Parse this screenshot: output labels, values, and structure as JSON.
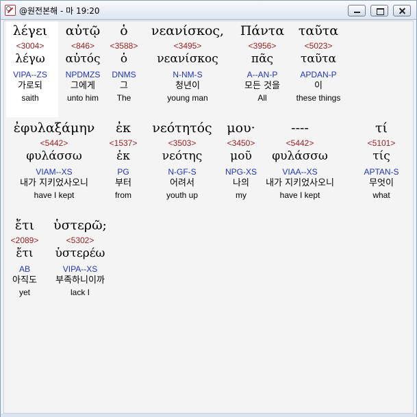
{
  "window": {
    "title": "@원전본해 - 마 19:20"
  },
  "rows": [
    {
      "words": [
        {
          "greek": "λέγει",
          "strong": "<3004>",
          "lemma": "λέγω",
          "parse": "VIPA--ZS",
          "korean": "가로되",
          "english": "saith"
        },
        {
          "greek": "αὐτῷ",
          "strong": "<846>",
          "lemma": "αὐτός",
          "parse": "NPDMZS",
          "korean": "그에게",
          "english": "unto him"
        },
        {
          "greek": "ὁ",
          "strong": "<3588>",
          "lemma": "ὁ",
          "parse": "DNMS",
          "korean": "그",
          "english": "The"
        },
        {
          "greek": "νεανίσκος,",
          "strong": "<3495>",
          "lemma": "νεανίσκος",
          "parse": "N-NM-S",
          "korean": "청년이",
          "english": "young man"
        },
        {
          "greek": "Πάντα",
          "strong": "<3956>",
          "lemma": "πᾶς",
          "parse": "A--AN-P",
          "korean": "모든 것을",
          "english": "All"
        },
        {
          "greek": "ταῦτα",
          "strong": "<5023>",
          "lemma": "ταῦτα",
          "parse": "APDAN-P",
          "korean": "이",
          "english": "these things"
        }
      ]
    },
    {
      "words": [
        {
          "greek": "ἐφυλαξάμην",
          "strong": "<5442>",
          "lemma": "φυλάσσω",
          "parse": "VIAM--XS",
          "korean": "내가 지키었사오니",
          "english": "have I kept"
        },
        {
          "greek": "ἐκ",
          "strong": "<1537>",
          "lemma": "ἐκ",
          "parse": "PG",
          "korean": "부터",
          "english": "from"
        },
        {
          "greek": "νεότητός",
          "strong": "<3503>",
          "lemma": "νεότης",
          "parse": "N-GF-S",
          "korean": "어려서",
          "english": "youth up"
        },
        {
          "greek": "μου·",
          "strong": "<3450>",
          "lemma": "μοῦ",
          "parse": "NPG-XS",
          "korean": "나의",
          "english": "my"
        },
        {
          "greek": "----",
          "strong": "<5442>",
          "lemma": "φυλάσσω",
          "parse": "VIAA--XS",
          "korean": "내가 지키었사오니",
          "english": "have I kept"
        },
        {
          "greek": "τί",
          "strong": "<5101>",
          "lemma": "τίς",
          "parse": "APTAN-S",
          "korean": "무엇이",
          "english": "what"
        }
      ]
    },
    {
      "words": [
        {
          "greek": "ἔτι",
          "strong": "<2089>",
          "lemma": "ἔτι",
          "parse": "AB",
          "korean": "아직도",
          "english": "yet"
        },
        {
          "greek": "ὑστερῶ;",
          "strong": "<5302>",
          "lemma": "ὑστερέω",
          "parse": "VIPA--XS",
          "korean": "부족하니이까",
          "english": "lack I"
        }
      ]
    }
  ]
}
